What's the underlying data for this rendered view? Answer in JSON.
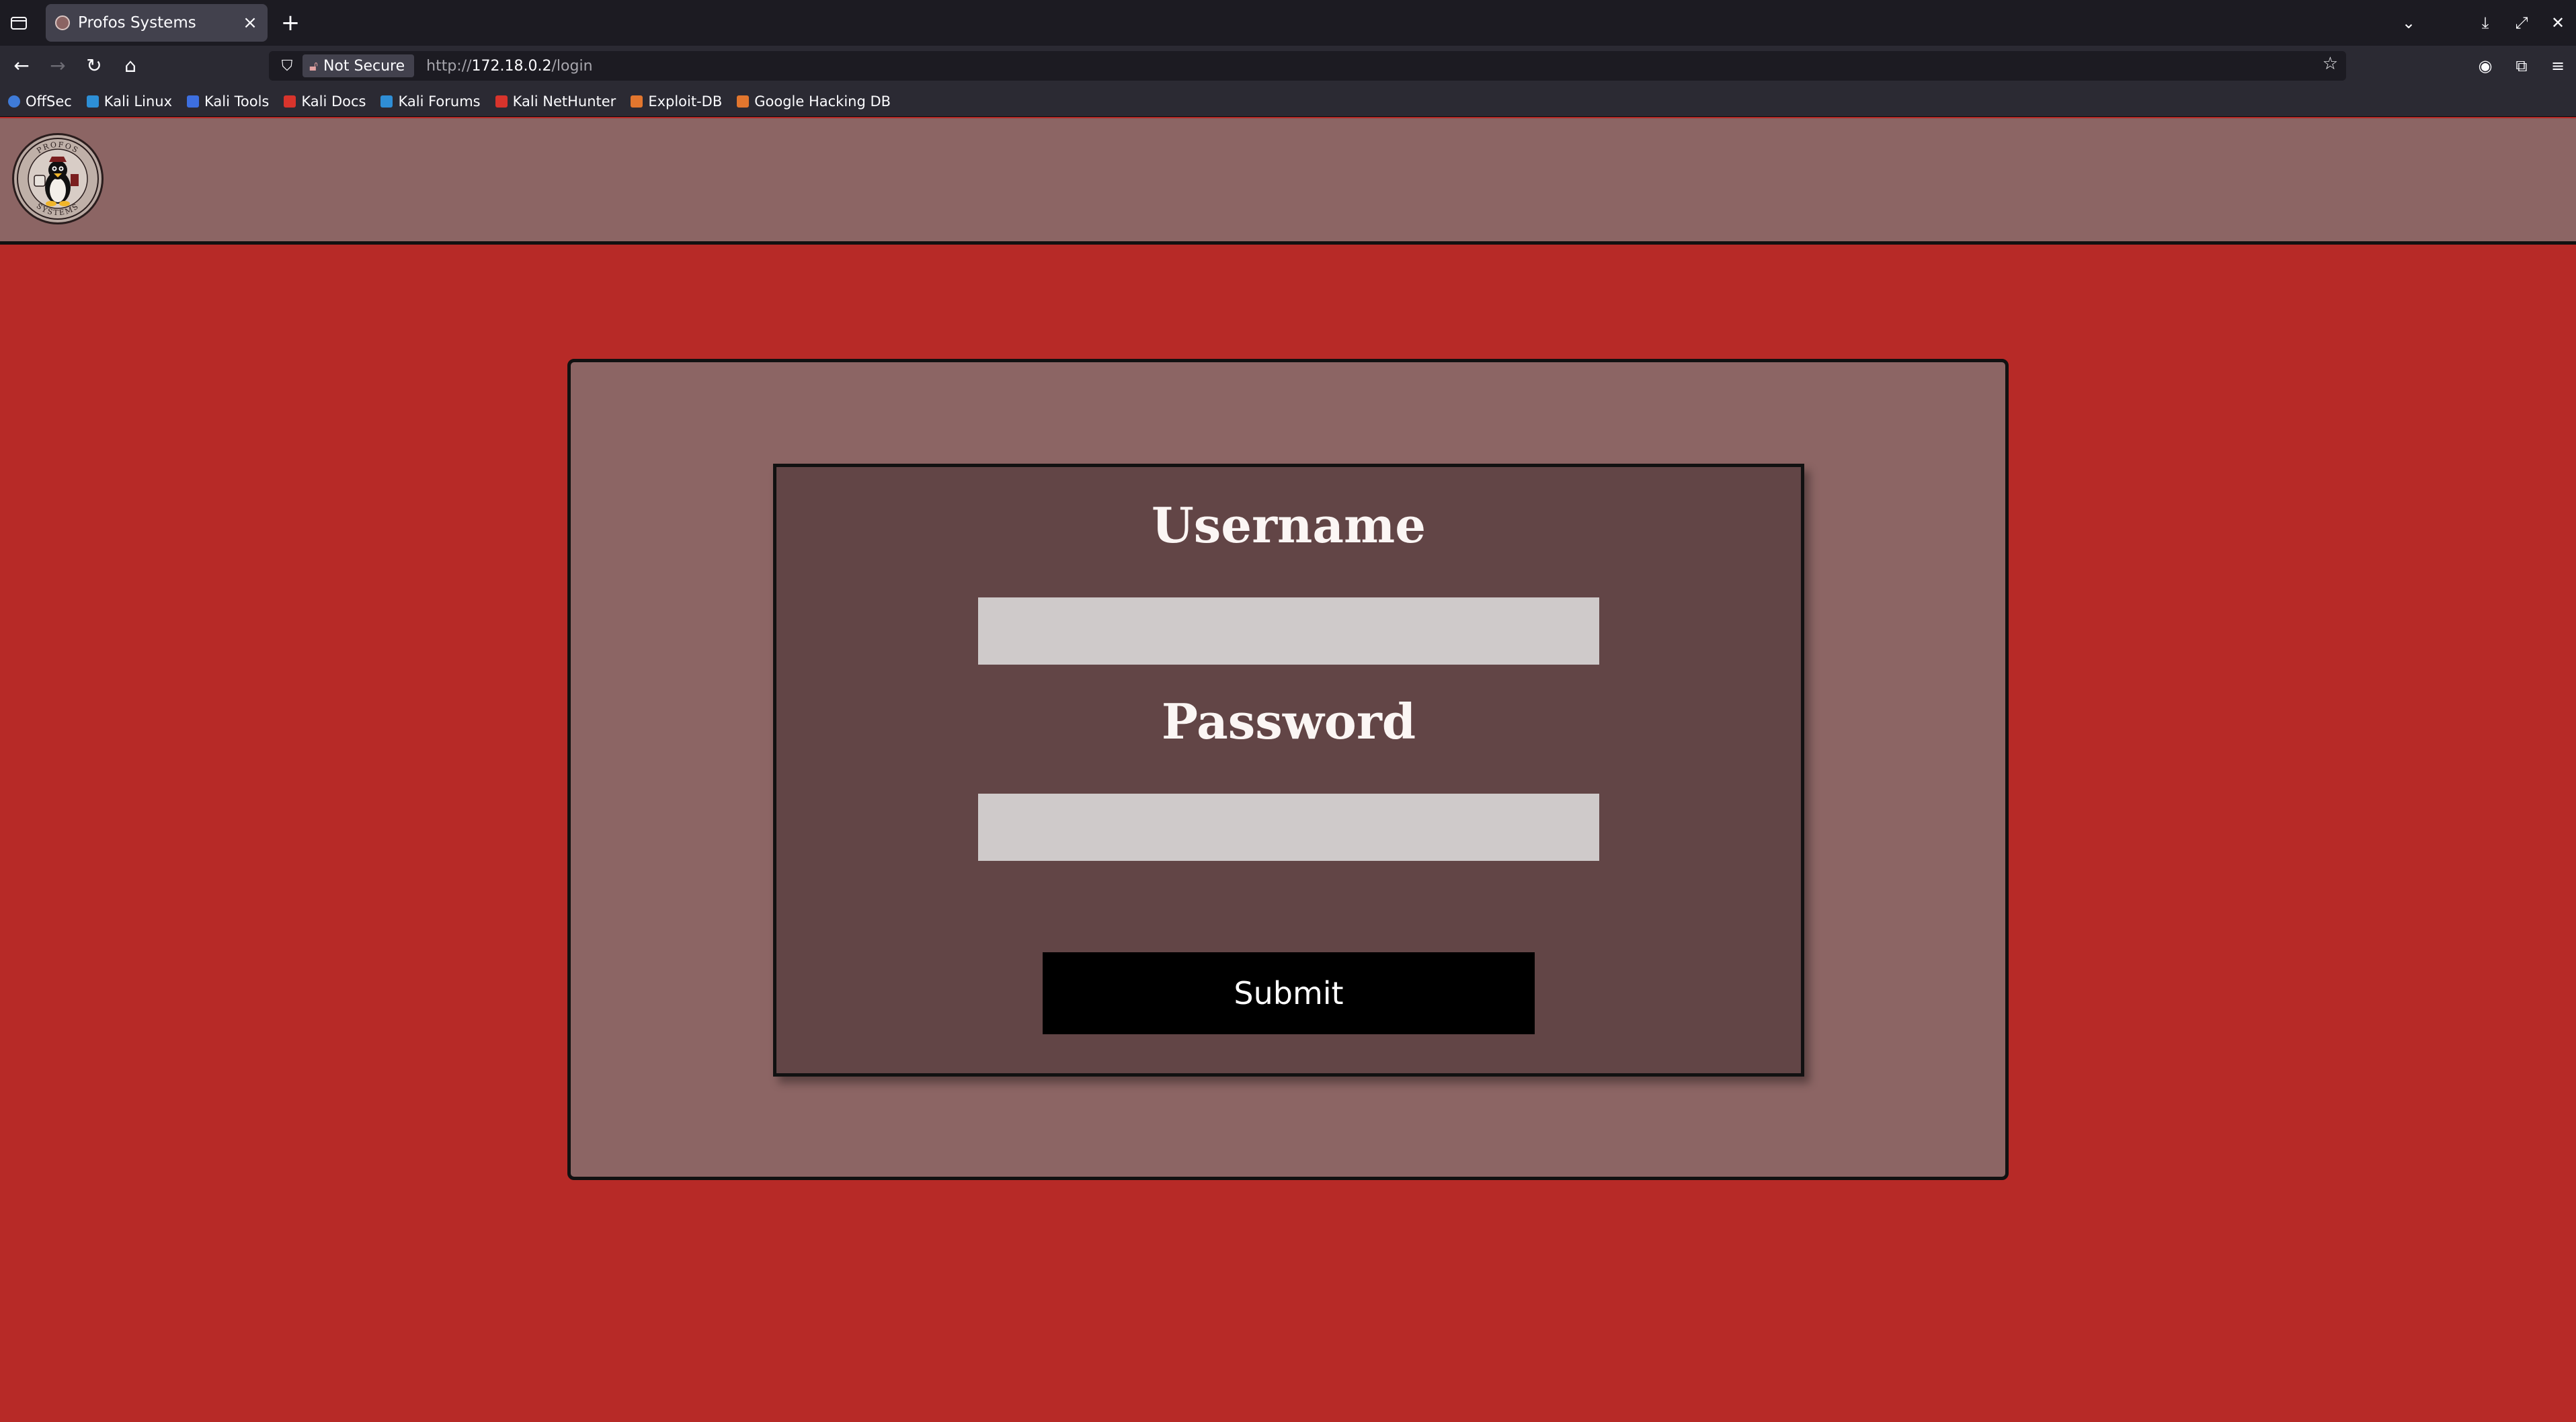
{
  "browser": {
    "tab_title": "Profos Systems",
    "tab_close": "×",
    "new_tab": "+",
    "security_label": "Not Secure",
    "url_prefix": "http://",
    "url_host": "172.18.0.2",
    "url_path": "/login",
    "bookmarks": [
      {
        "label": "OffSec",
        "color": "#3f7bd8"
      },
      {
        "label": "Kali Linux",
        "color": "#2d8fd6"
      },
      {
        "label": "Kali Tools",
        "color": "#3d6fe0"
      },
      {
        "label": "Kali Docs",
        "color": "#d8342c"
      },
      {
        "label": "Kali Forums",
        "color": "#2f8ed6"
      },
      {
        "label": "Kali NetHunter",
        "color": "#d8342c"
      },
      {
        "label": "Exploit-DB",
        "color": "#e2762e"
      },
      {
        "label": "Google Hacking DB",
        "color": "#e2762e"
      }
    ]
  },
  "page": {
    "logo_text": "PROFOS SYSTEMS",
    "username_label": "Username",
    "password_label": "Password",
    "username_value": "",
    "password_value": "",
    "submit_label": "Submit"
  },
  "colors": {
    "background": "#b72a27",
    "header": "#8c6564",
    "panel": "#8c6564",
    "form": "#624546",
    "input": "#cfcaca",
    "button": "#000000"
  }
}
